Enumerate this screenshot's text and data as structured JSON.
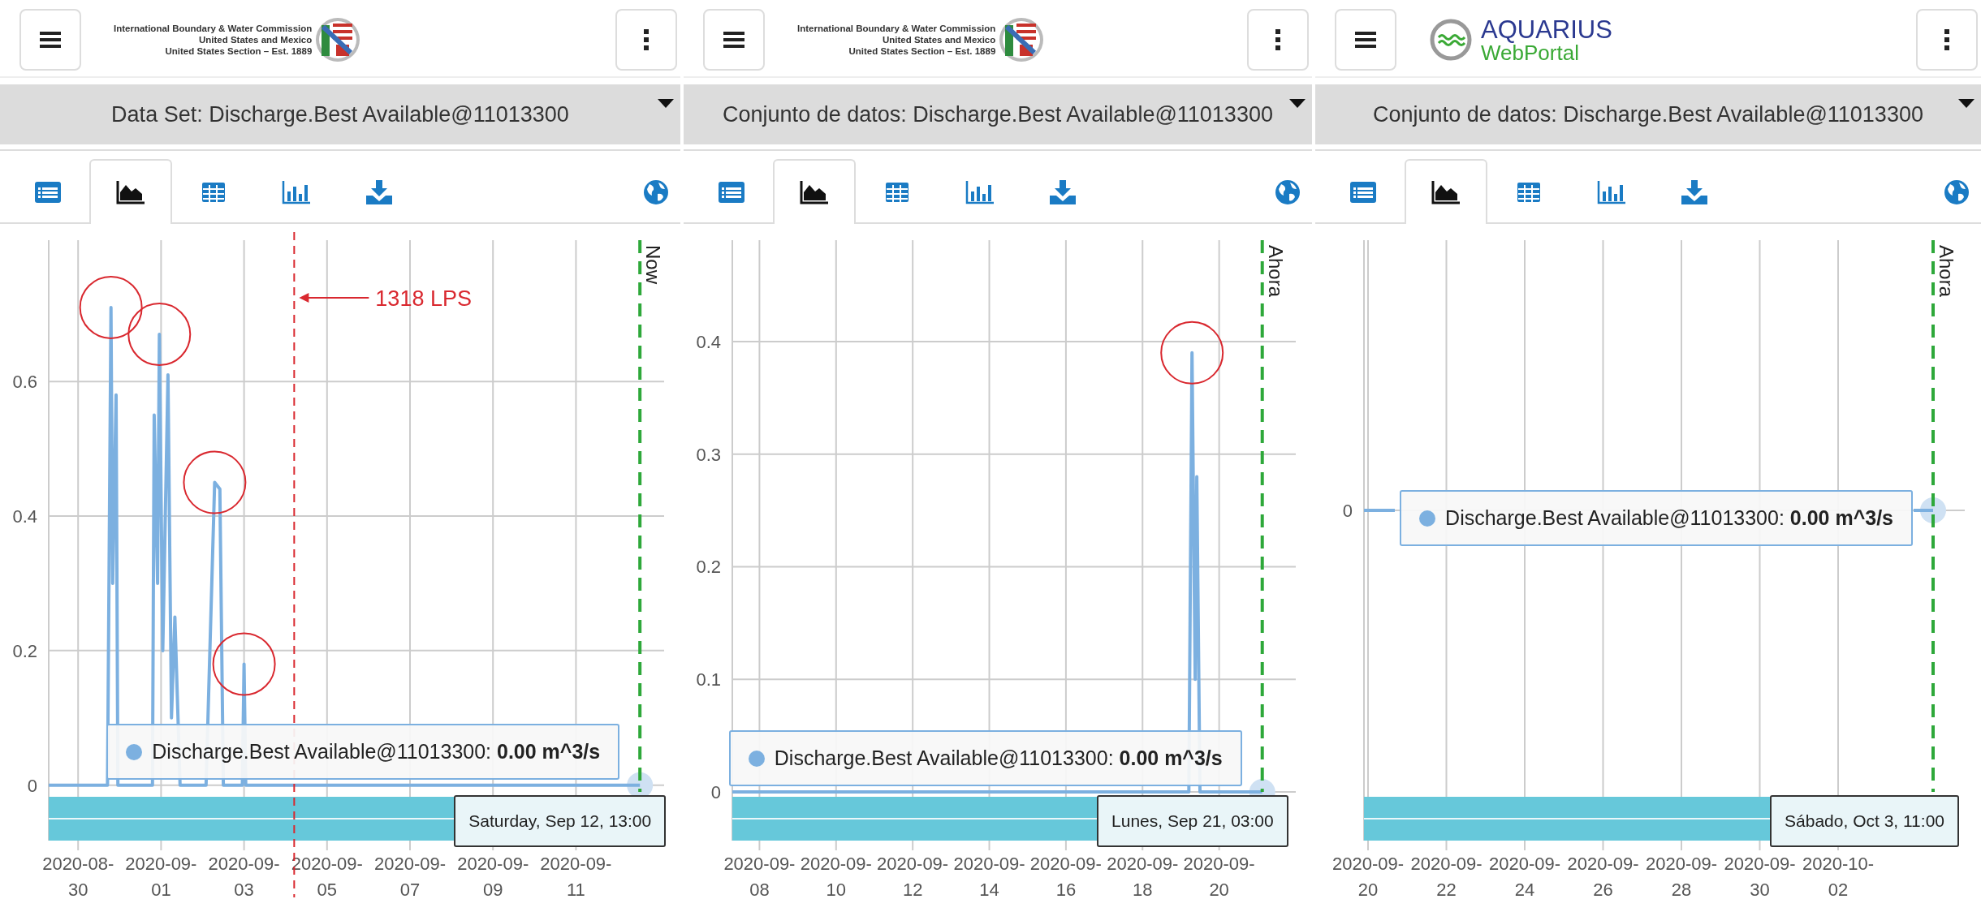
{
  "panels": [
    {
      "logo": {
        "kind": "ibwc",
        "lines": [
          "International Boundary & Water Commission",
          "United States and Mexico",
          "United States Section – Est. 1889"
        ]
      },
      "dataset": "Data Set: Discharge.Best Available@11013300",
      "tabs": [
        {
          "kind": "list",
          "selected": false
        },
        {
          "kind": "area",
          "selected": true
        },
        {
          "kind": "table",
          "selected": false
        },
        {
          "kind": "bars",
          "selected": false
        },
        {
          "kind": "download",
          "selected": false
        },
        {
          "kind": "globe",
          "selected": false
        }
      ],
      "chart": {
        "now_label": "Now",
        "circle_peaks": true,
        "tooltip": "Discharge.Best Available@11013300: **0.00 m^3/s**",
        "date_tooltip": "Saturday, Sep 12, 13:00",
        "chart_data": {
          "type": "line",
          "grid": true,
          "x": [
            "2020-08-29T07:00",
            "2020-08-30T17:00",
            "2020-08-30T19:00",
            "2020-08-30T20:00",
            "2020-08-30T22:00",
            "2020-08-30T23:00",
            "2020-08-31T19:00",
            "2020-08-31T20:00",
            "2020-08-31T22:00",
            "2020-08-31T23:00",
            "2020-09-01T01:00",
            "2020-09-01T04:00",
            "2020-09-01T06:00",
            "2020-09-01T08:00",
            "2020-09-01T11:00",
            "2020-09-02T02:00",
            "2020-09-02T07:00",
            "2020-09-02T10:00",
            "2020-09-02T12:00",
            "2020-09-02T23:00",
            "2020-09-03T00:00",
            "2020-09-03T01:00",
            "2020-09-12T13:00"
          ],
          "series": [
            {
              "color": "#7cb0e0",
              "values": [
                0,
                0,
                0.71,
                0.3,
                0.58,
                0,
                0,
                0.55,
                0.3,
                0.67,
                0.2,
                0.61,
                0.1,
                0.25,
                0,
                0,
                0.45,
                0.44,
                0,
                0,
                0.18,
                0,
                0
              ]
            }
          ],
          "xlim": [
            "2020-08-29T07:00",
            "2020-09-13T03:00"
          ],
          "ylim": [
            -0.01,
            0.81
          ],
          "xticks": [
            "2020-08-30",
            "2020-09-01",
            "2020-09-03",
            "2020-09-05",
            "2020-09-07",
            "2020-09-09",
            "2020-09-11"
          ],
          "yticks": [
            0,
            0.2,
            0.4,
            0.6
          ],
          "ref_lines": [
            {
              "axis": "x",
              "value": "2020-09-04T05:00",
              "color": "#d9282f"
            },
            {
              "axis": "x",
              "value": "2020-09-12T13:00",
              "color": "#2ea83a"
            }
          ],
          "annotations": [
            "1318 LPS"
          ]
        }
      }
    },
    {
      "logo": {
        "kind": "ibwc",
        "lines": [
          "International Boundary & Water Commission",
          "United States and Mexico",
          "United States Section – Est. 1889"
        ]
      },
      "dataset": "Conjunto de datos: Discharge.Best Available@11013300",
      "tabs": [
        {
          "kind": "list",
          "selected": false
        },
        {
          "kind": "area",
          "selected": true
        },
        {
          "kind": "table",
          "selected": false
        },
        {
          "kind": "bars",
          "selected": false
        },
        {
          "kind": "download",
          "selected": false
        },
        {
          "kind": "globe",
          "selected": false
        }
      ],
      "chart": {
        "now_label": "Ahora",
        "circle_peaks": true,
        "tooltip": "Discharge.Best Available@11013300: **0.00 m^3/s**",
        "date_tooltip": "Lunes, Sep 21, 03:00",
        "chart_data": {
          "type": "line",
          "grid": true,
          "x": [
            "2020-09-07T07:00",
            "2020-09-19T05:00",
            "2020-09-19T07:00",
            "2020-09-19T09:00",
            "2020-09-19T10:00",
            "2020-09-19T12:00",
            "2020-09-21T03:00"
          ],
          "series": [
            {
              "color": "#7cb0e0",
              "values": [
                0,
                0,
                0.39,
                0.1,
                0.28,
                0,
                0
              ]
            }
          ],
          "xlim": [
            "2020-09-07T07:00",
            "2020-09-22T00:00"
          ],
          "ylim": [
            0,
            0.49
          ],
          "xticks": [
            "2020-09-08",
            "2020-09-10",
            "2020-09-12",
            "2020-09-14",
            "2020-09-16",
            "2020-09-18",
            "2020-09-20"
          ],
          "yticks": [
            0,
            0.1,
            0.2,
            0.3,
            0.4
          ],
          "ref_lines": [
            {
              "axis": "x",
              "value": "2020-09-21T03:00",
              "color": "#2ea83a"
            }
          ]
        }
      }
    },
    {
      "logo": {
        "kind": "aquarius",
        "lines": [
          "AQUARIUS",
          "WebPortal"
        ]
      },
      "dataset": "Conjunto de datos: Discharge.Best Available@11013300",
      "tabs": [
        {
          "kind": "list",
          "selected": false
        },
        {
          "kind": "area",
          "selected": true
        },
        {
          "kind": "table",
          "selected": false
        },
        {
          "kind": "bars",
          "selected": false
        },
        {
          "kind": "download",
          "selected": false
        },
        {
          "kind": "globe",
          "selected": false
        }
      ],
      "chart": {
        "now_label": "Ahora",
        "tooltip": "Discharge.Best Available@11013300: **0.00 m^3/s**",
        "date_tooltip": "Sábado, Oct 3, 11:00",
        "x_labels": [
          "2020-09-20",
          "2020-09-22",
          "2020-09-24",
          "2020-09-26",
          "2020-09-28",
          "2020-09-30",
          "2020-10-02"
        ],
        "y_labels": [
          "0"
        ]
      }
    }
  ]
}
